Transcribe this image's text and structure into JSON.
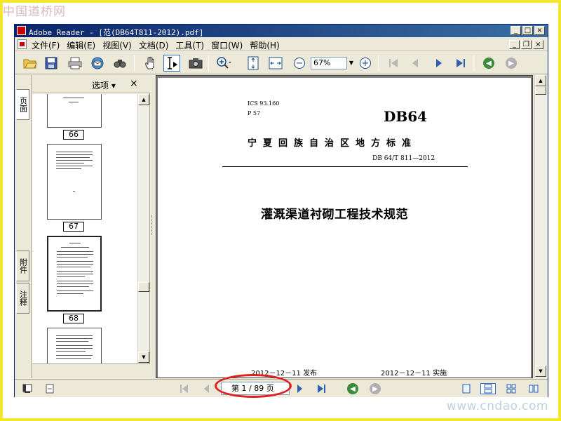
{
  "watermark": {
    "top": "中国道桥网",
    "bottom": "www.cndao.com"
  },
  "window": {
    "title": "Adobe Reader - [范(DB64T811-2012).pdf]",
    "minimize": "_",
    "maximize": "□",
    "close": "×",
    "doc_minimize": "_",
    "doc_restore": "❐",
    "doc_close": "×"
  },
  "menu": {
    "items": [
      {
        "label": "文件(F)"
      },
      {
        "label": "编辑(E)"
      },
      {
        "label": "视图(V)"
      },
      {
        "label": "文档(D)"
      },
      {
        "label": "工具(T)"
      },
      {
        "label": "窗口(W)"
      },
      {
        "label": "帮助(H)"
      }
    ]
  },
  "toolbar": {
    "zoom_value": "67%",
    "icons": [
      "open-icon",
      "save-icon",
      "print-icon",
      "email-icon",
      "search-icon",
      "hand-tool-icon",
      "select-text-icon",
      "snapshot-icon",
      "zoom-in-tool-icon",
      "fit-page-icon",
      "fit-width-icon",
      "zoom-out-icon",
      "zoom-in-icon",
      "first-page-icon",
      "previous-page-icon",
      "next-page-icon",
      "last-page-icon",
      "go-back-icon",
      "go-forward-icon"
    ]
  },
  "nav": {
    "tabs": [
      "页面",
      "附件",
      "注释"
    ],
    "options_label": "选项 ▾",
    "close_label": "×",
    "thumbnails": [
      {
        "page": "66"
      },
      {
        "page": "67"
      },
      {
        "page": "68"
      }
    ]
  },
  "document": {
    "ics": "ICS 93.160",
    "class_code": "P 57",
    "standard_code": "DB64",
    "organization": "宁夏回族自治区地方标准",
    "standard_number": "DB 64/T 811—2012",
    "title": "灌溉渠道衬砌工程技术规范",
    "publish_date": "2012－12－11 发布",
    "effective_date": "2012－12－11 实施"
  },
  "status": {
    "page_indicator": "第 1 / 89 页",
    "current_page": 1,
    "total_pages": 89
  },
  "colors": {
    "frame": "#f3e62f",
    "titlebar_start": "#0a246a",
    "titlebar_end": "#3a6ea5",
    "chrome": "#ece9d8",
    "highlight_ring": "#e02020",
    "go_button": "#3c8c3c"
  }
}
